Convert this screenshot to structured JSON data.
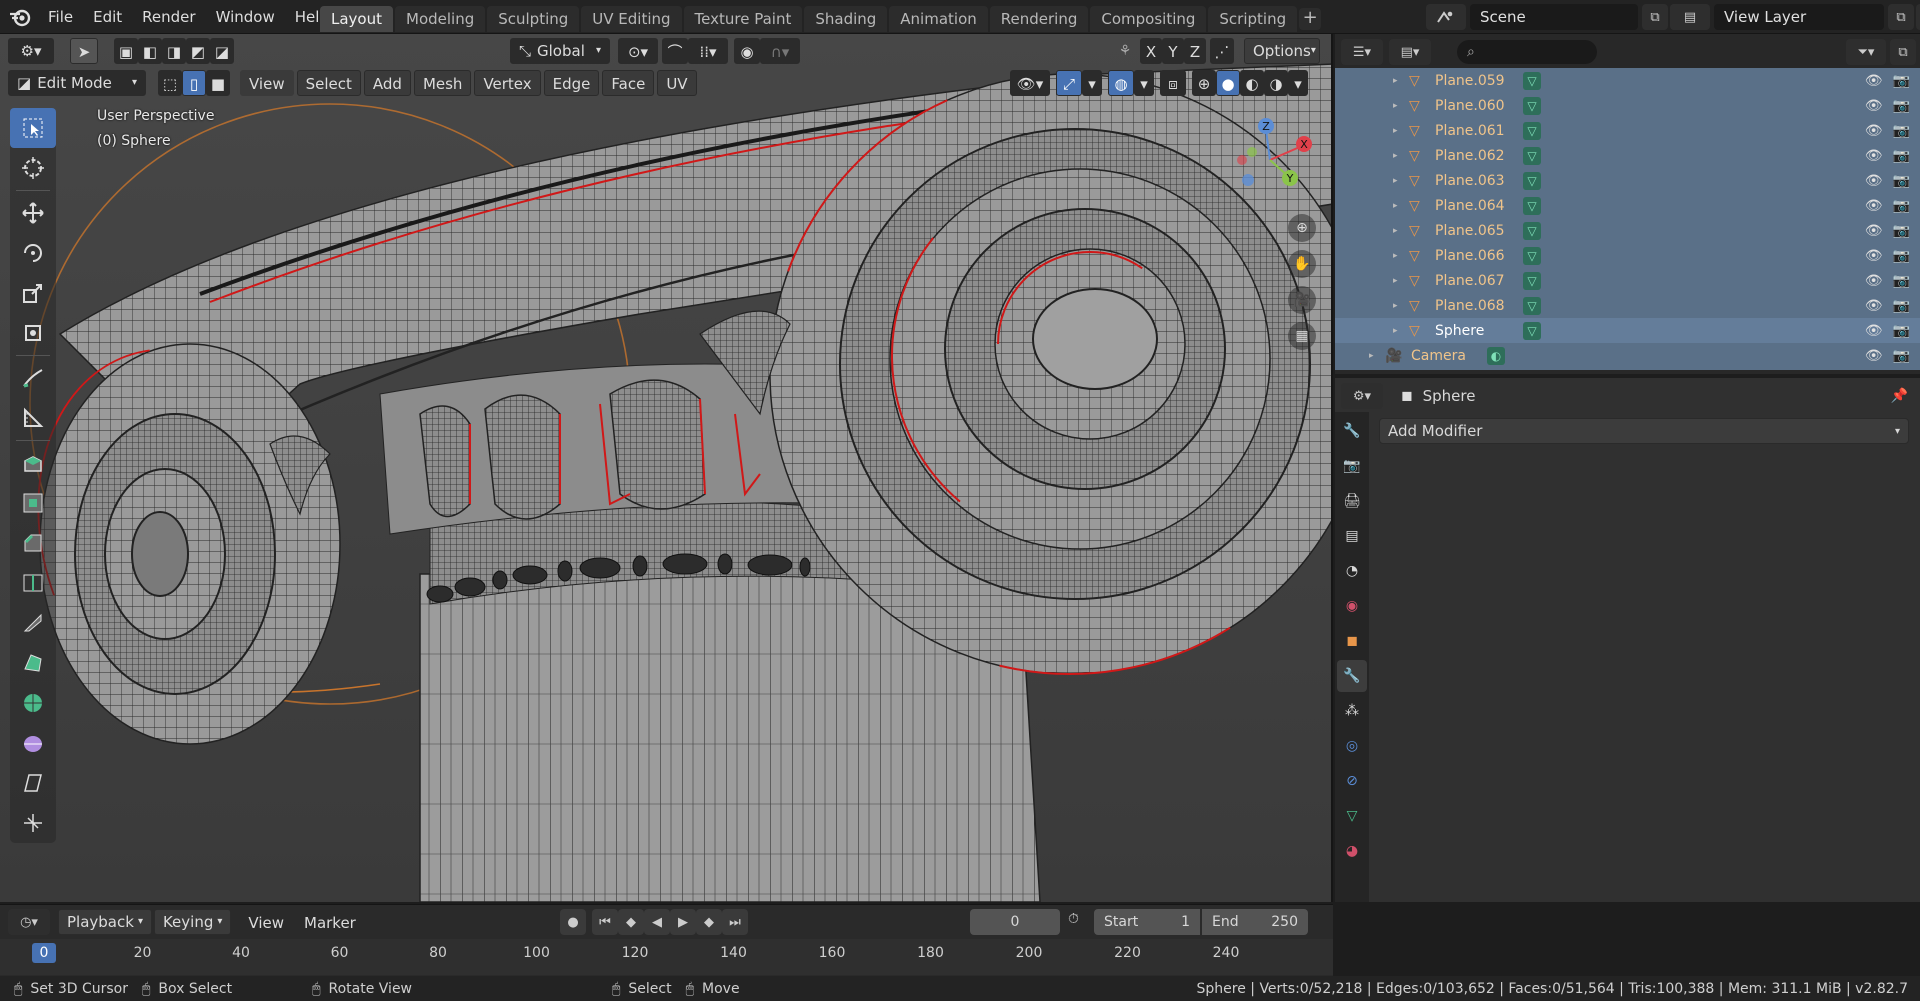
{
  "topbar": {
    "menus": [
      "File",
      "Edit",
      "Render",
      "Window",
      "Help"
    ],
    "workspaces": [
      "Layout",
      "Modeling",
      "Sculpting",
      "UV Editing",
      "Texture Paint",
      "Shading",
      "Animation",
      "Rendering",
      "Compositing",
      "Scripting"
    ],
    "active_workspace": "Layout",
    "add_workspace": "+",
    "scene": "Scene",
    "view_layer": "View Layer"
  },
  "viewport": {
    "transform_orientation": "Global",
    "axes": [
      "X",
      "Y",
      "Z"
    ],
    "options": "Options",
    "mode": "Edit Mode",
    "menus": [
      "View",
      "Select",
      "Add",
      "Mesh",
      "Vertex",
      "Edge",
      "Face",
      "UV"
    ],
    "overlay_line1": "User Perspective",
    "overlay_line2": "(0) Sphere",
    "gizmo_labels": [
      "Z",
      "X",
      "Y"
    ]
  },
  "outliner": {
    "items": [
      {
        "name": "Plane.059",
        "type": "mesh"
      },
      {
        "name": "Plane.060",
        "type": "mesh"
      },
      {
        "name": "Plane.061",
        "type": "mesh"
      },
      {
        "name": "Plane.062",
        "type": "mesh"
      },
      {
        "name": "Plane.063",
        "type": "mesh"
      },
      {
        "name": "Plane.064",
        "type": "mesh"
      },
      {
        "name": "Plane.065",
        "type": "mesh"
      },
      {
        "name": "Plane.066",
        "type": "mesh"
      },
      {
        "name": "Plane.067",
        "type": "mesh"
      },
      {
        "name": "Plane.068",
        "type": "mesh"
      },
      {
        "name": "Sphere",
        "type": "mesh",
        "selected": true
      },
      {
        "name": "Camera",
        "type": "camera"
      }
    ]
  },
  "properties": {
    "object_name": "Sphere",
    "add_modifier": "Add Modifier"
  },
  "timeline": {
    "menus": [
      "Playback",
      "Keying",
      "View",
      "Marker"
    ],
    "current_frame": "0",
    "start_label": "Start",
    "start_value": "1",
    "end_label": "End",
    "end_value": "250",
    "ticks": [
      "0",
      "20",
      "40",
      "60",
      "80",
      "100",
      "120",
      "140",
      "160",
      "180",
      "200",
      "220",
      "240"
    ]
  },
  "status": {
    "left": [
      "Set 3D Cursor",
      "Box Select",
      "Rotate View",
      "Select",
      "Move"
    ],
    "stats": "Sphere | Verts:0/52,218 | Edges:0/103,652 | Faces:0/51,564 | Tris:100,388 | Mem: 311.1 MiB | v2.82.7"
  },
  "colors": {
    "accent": "#4772b3",
    "mesh_orange": "#e8964a",
    "data_green": "#4bbb8b",
    "seam_red": "#e02020"
  }
}
